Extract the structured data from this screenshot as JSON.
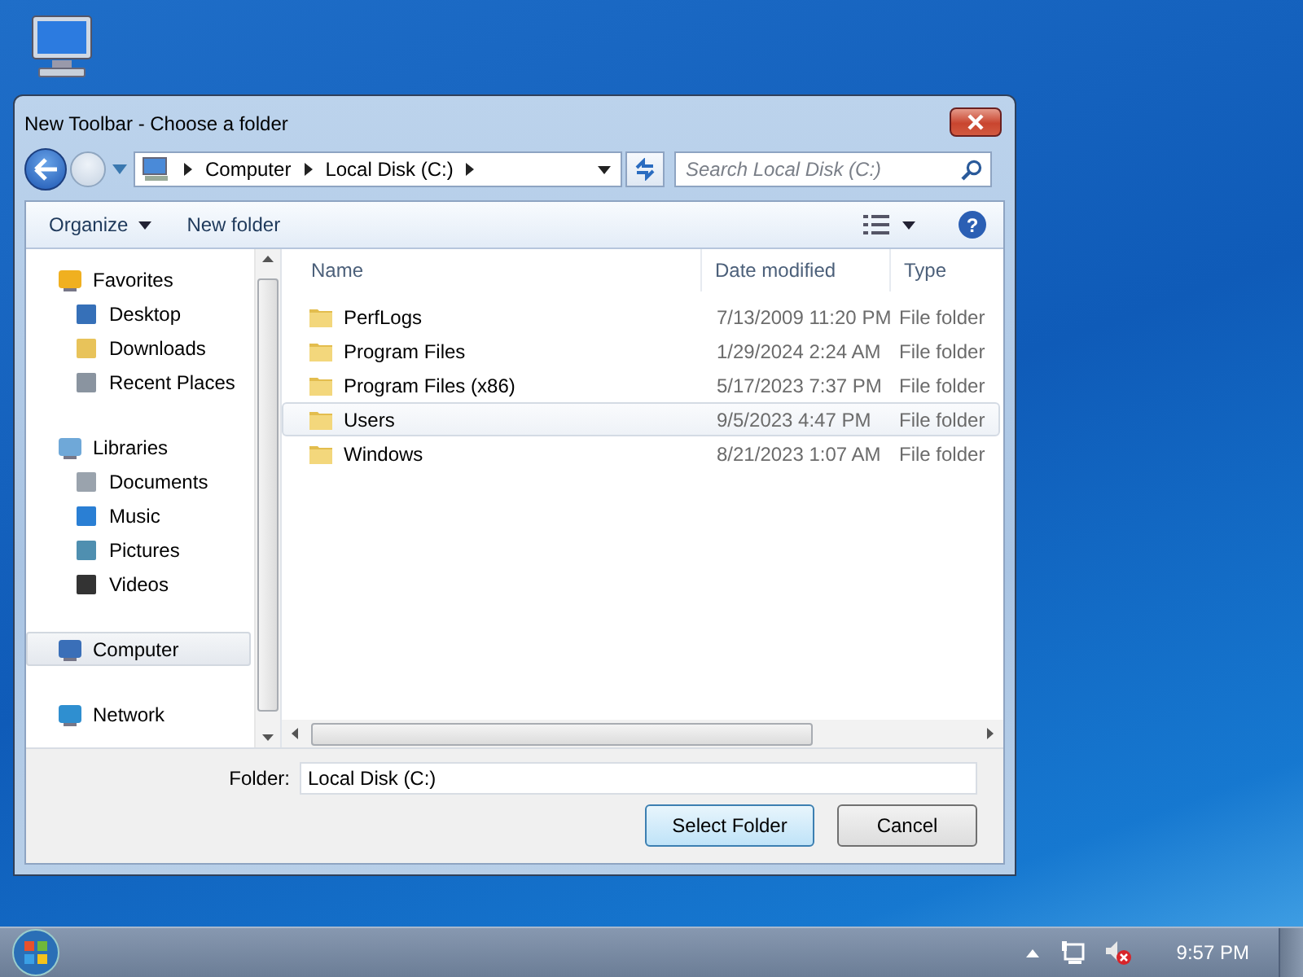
{
  "window": {
    "title": "New Toolbar - Choose a folder"
  },
  "address": {
    "crumbs": [
      "Computer",
      "Local Disk (C:)"
    ]
  },
  "search": {
    "placeholder": "Search Local Disk (C:)"
  },
  "toolbar": {
    "organize": "Organize",
    "new_folder": "New folder",
    "help": "?"
  },
  "sidebar": {
    "items": [
      {
        "label": "Favorites",
        "selected": false,
        "children": [
          {
            "label": "Desktop",
            "selected": false
          },
          {
            "label": "Downloads",
            "selected": false
          },
          {
            "label": "Recent Places",
            "selected": false
          }
        ]
      },
      {
        "label": "Libraries",
        "selected": false,
        "children": [
          {
            "label": "Documents",
            "selected": false
          },
          {
            "label": "Music",
            "selected": false
          },
          {
            "label": "Pictures",
            "selected": false
          },
          {
            "label": "Videos",
            "selected": false
          }
        ]
      },
      {
        "label": "Computer",
        "selected": true
      },
      {
        "label": "Network",
        "selected": false
      }
    ]
  },
  "table": {
    "columns": [
      "Name",
      "Date modified",
      "Type"
    ],
    "rows": [
      {
        "name": "PerfLogs",
        "date": "7/13/2009 11:20 PM",
        "type": "File folder",
        "selected": false
      },
      {
        "name": "Program Files",
        "date": "1/29/2024 2:24 AM",
        "type": "File folder",
        "selected": false
      },
      {
        "name": "Program Files (x86)",
        "date": "5/17/2023 7:37 PM",
        "type": "File folder",
        "selected": false
      },
      {
        "name": "Users",
        "date": "9/5/2023 4:47 PM",
        "type": "File folder",
        "selected": true
      },
      {
        "name": "Windows",
        "date": "8/21/2023 1:07 AM",
        "type": "File folder",
        "selected": false
      }
    ]
  },
  "footer": {
    "folder_label": "Folder:",
    "folder_value": "Local Disk (C:)",
    "buttons": [
      "Select Folder",
      "Cancel"
    ]
  },
  "taskbar": {
    "clock": "9:57 PM"
  }
}
